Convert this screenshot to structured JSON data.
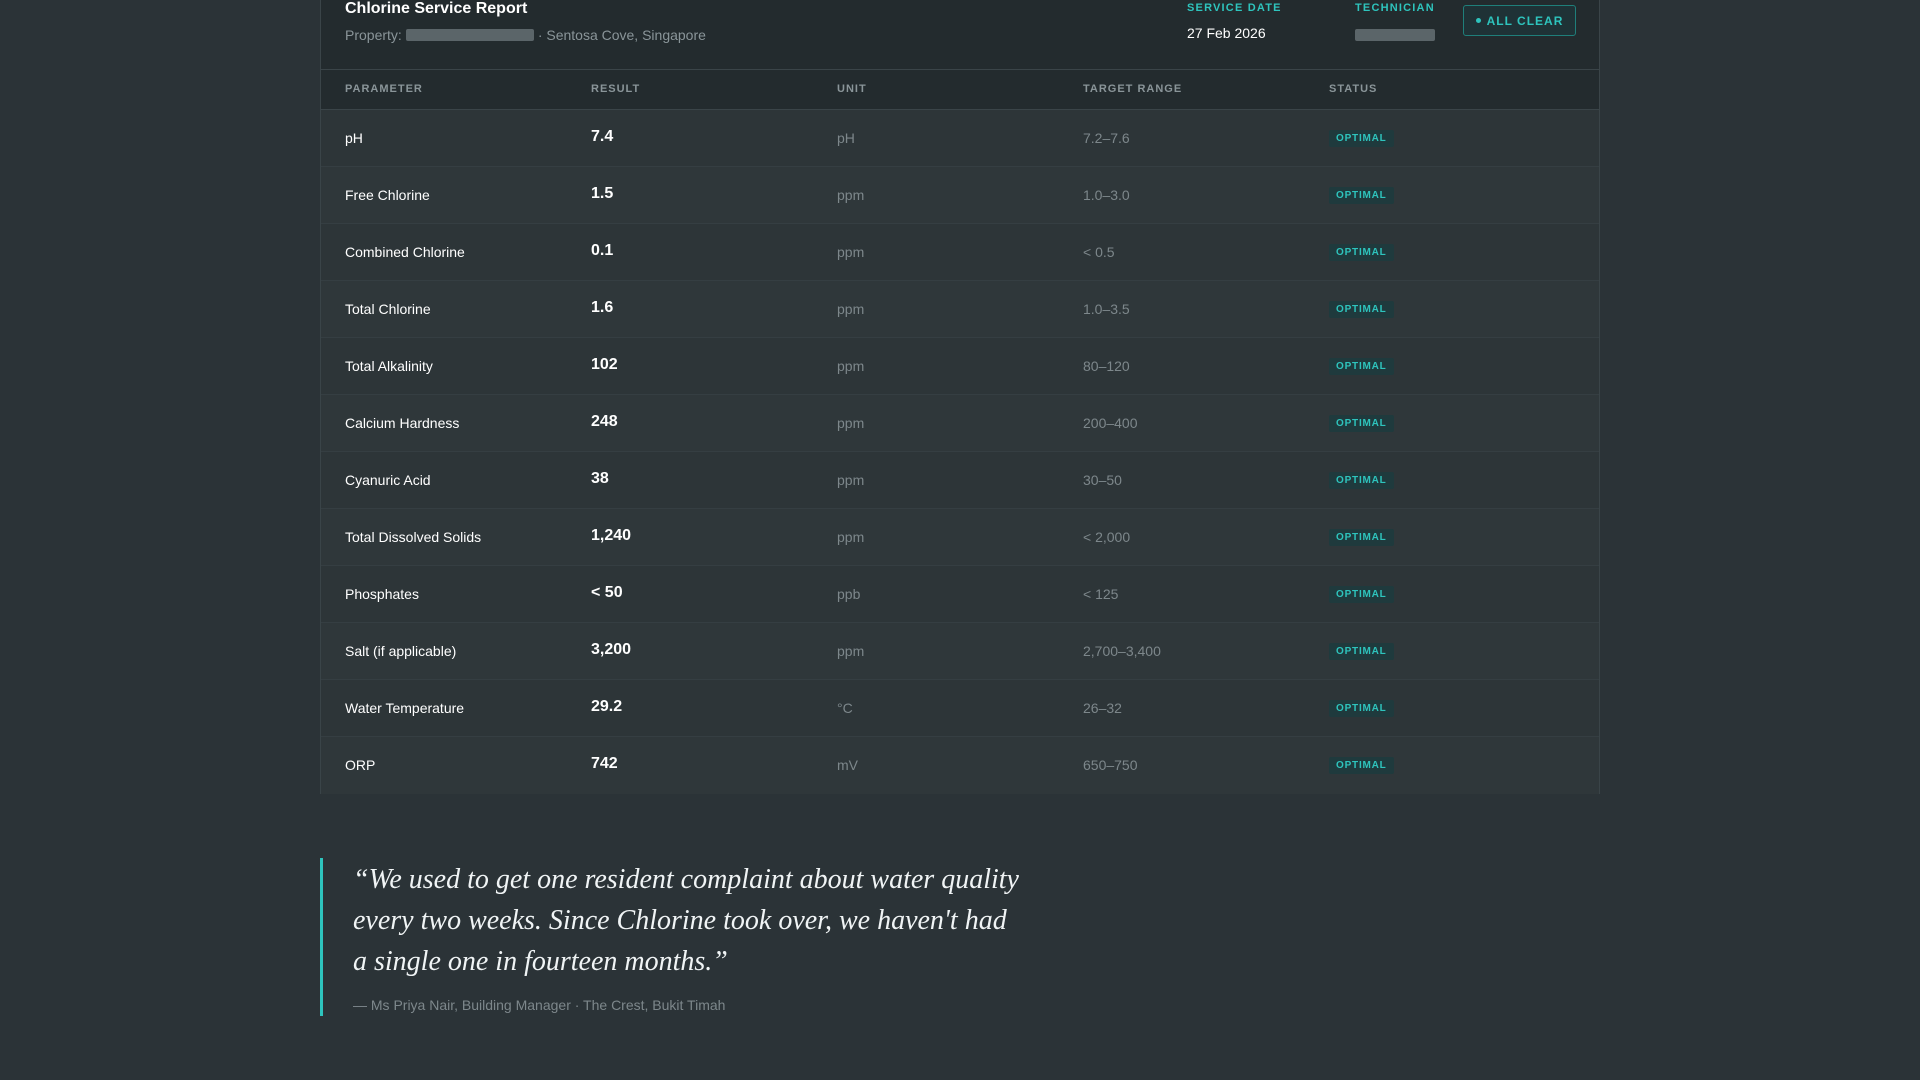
{
  "header": {
    "title": "Chlorine Service Report",
    "property_label": "Property:",
    "property_location": "· Sentosa Cove, Singapore",
    "service_date_label": "SERVICE DATE",
    "service_date": "27 Feb 2026",
    "technician_label": "TECHNICIAN",
    "all_clear_label": "ALL CLEAR"
  },
  "table": {
    "headers": [
      "PARAMETER",
      "RESULT",
      "UNIT",
      "TARGET RANGE",
      "STATUS"
    ],
    "rows": [
      {
        "parameter": "pH",
        "result": "7.4",
        "unit": "pH",
        "range": "7.2–7.6",
        "status": "OPTIMAL"
      },
      {
        "parameter": "Free Chlorine",
        "result": "1.5",
        "unit": "ppm",
        "range": "1.0–3.0",
        "status": "OPTIMAL"
      },
      {
        "parameter": "Combined Chlorine",
        "result": "0.1",
        "unit": "ppm",
        "range": "< 0.5",
        "status": "OPTIMAL"
      },
      {
        "parameter": "Total Chlorine",
        "result": "1.6",
        "unit": "ppm",
        "range": "1.0–3.5",
        "status": "OPTIMAL"
      },
      {
        "parameter": "Total Alkalinity",
        "result": "102",
        "unit": "ppm",
        "range": "80–120",
        "status": "OPTIMAL"
      },
      {
        "parameter": "Calcium Hardness",
        "result": "248",
        "unit": "ppm",
        "range": "200–400",
        "status": "OPTIMAL"
      },
      {
        "parameter": "Cyanuric Acid",
        "result": "38",
        "unit": "ppm",
        "range": "30–50",
        "status": "OPTIMAL"
      },
      {
        "parameter": "Total Dissolved Solids",
        "result": "1,240",
        "unit": "ppm",
        "range": "< 2,000",
        "status": "OPTIMAL"
      },
      {
        "parameter": "Phosphates",
        "result": "< 50",
        "unit": "ppb",
        "range": "< 125",
        "status": "OPTIMAL"
      },
      {
        "parameter": "Salt (if applicable)",
        "result": "3,200",
        "unit": "ppm",
        "range": "2,700–3,400",
        "status": "OPTIMAL"
      },
      {
        "parameter": "Water Temperature",
        "result": "29.2",
        "unit": "°C",
        "range": "26–32",
        "status": "OPTIMAL"
      },
      {
        "parameter": "ORP",
        "result": "742",
        "unit": "mV",
        "range": "650–750",
        "status": "OPTIMAL"
      }
    ]
  },
  "testimonial": {
    "quote": "“We used to get one resident complaint about water quality every two weeks. Since Chlorine took over, we haven't had a single one in fourteen months.”",
    "attribution": "— Ms Priya Nair, Building Manager · The Crest, Bukit Timah"
  },
  "colors": {
    "accent": "#2ec4bd",
    "background": "#2b3337",
    "card": "#2d3538"
  }
}
